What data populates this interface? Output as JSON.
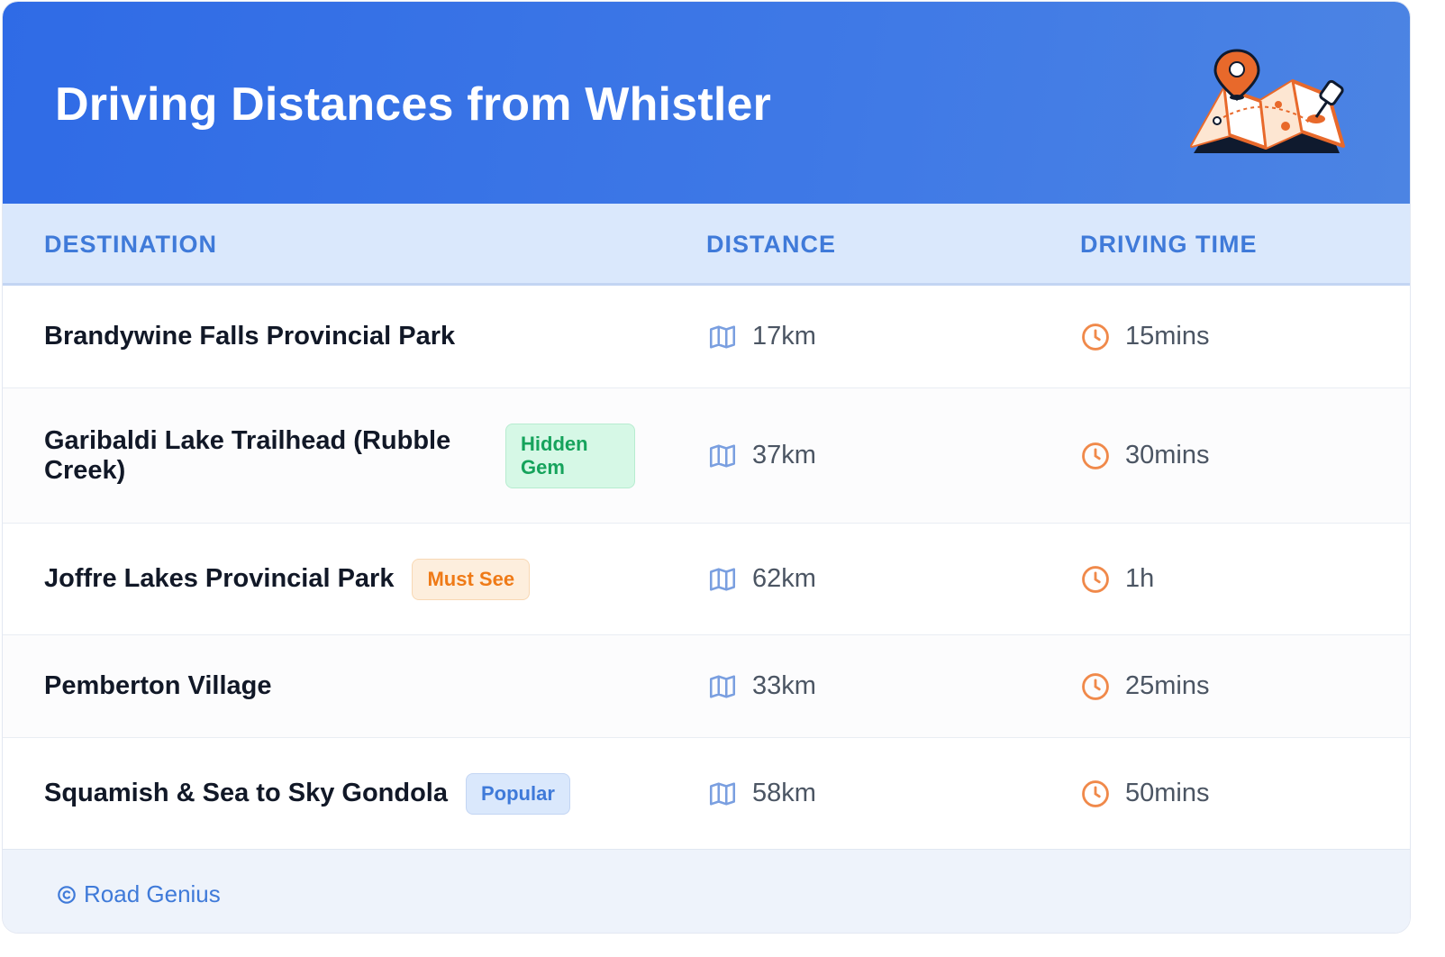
{
  "header": {
    "title": "Driving Distances from Whistler",
    "illustration": "map-with-location-pin-icon"
  },
  "columns": {
    "destination": "DESTINATION",
    "distance": "DISTANCE",
    "driving_time": "DRIVING TIME"
  },
  "rows": [
    {
      "destination": "Brandywine Falls Provincial Park",
      "badge": "",
      "distance": "17km",
      "time": "15mins"
    },
    {
      "destination": "Garibaldi Lake Trailhead (Rubble Creek)",
      "badge": "Hidden Gem",
      "distance": "37km",
      "time": "30mins"
    },
    {
      "destination": "Joffre Lakes Provincial Park",
      "badge": "Must See",
      "distance": "62km",
      "time": "1h"
    },
    {
      "destination": "Pemberton Village",
      "badge": "",
      "distance": "33km",
      "time": "25mins"
    },
    {
      "destination": "Squamish & Sea to Sky Gondola",
      "badge": "Popular",
      "distance": "58km",
      "time": "50mins"
    }
  ],
  "icons": {
    "distance": "map-icon",
    "time": "clock-icon",
    "credit": "copyright-icon"
  },
  "colors": {
    "header": "#2f6be6",
    "accent": "#3f7ad9",
    "clock": "#f0894a",
    "hidden_gem": "#16a35c",
    "must_see": "#ef7a17"
  },
  "footer": {
    "credit": "Road Genius"
  }
}
